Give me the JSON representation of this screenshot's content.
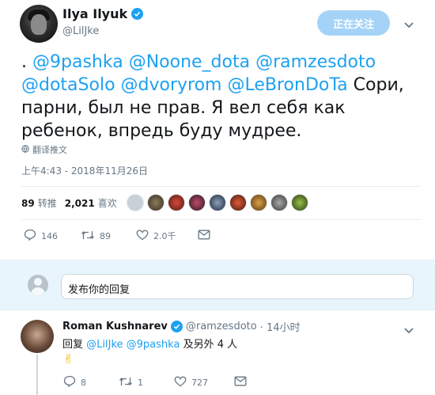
{
  "author": {
    "name": "Ilya Ilyuk",
    "handle": "@LilJke",
    "follow_label": "正在关注"
  },
  "tweet": {
    "prefix": ". ",
    "mentions": [
      "@9pashka",
      "@Noone_dota",
      "@ramzesdoto",
      "@dotaSolo",
      "@dvoryrom",
      "@LeBronDoTa"
    ],
    "body": "Сори, парни, был не прав. Я вел себя как ребенок, впредь буду мудрее.",
    "translate_label": "翻译推文",
    "timestamp": "上午4:43 - 2018年11月26日"
  },
  "stats": {
    "retweets_count": "89",
    "retweets_label": "转推",
    "likes_count": "2,021",
    "likes_label": "喜欢"
  },
  "actions": {
    "replies": "146",
    "retweets": "89",
    "likes": "2.0千"
  },
  "reply_box": {
    "placeholder": "发布你的回复"
  },
  "reply": {
    "name": "Roman Kushnarev",
    "handle": "@ramzesdoto",
    "time": "· 14小时",
    "replying_to_prefix": "回复",
    "replying_to_users": "@LilJke @9pashka",
    "replying_to_suffix": "及另外 4 人",
    "text": "✌",
    "replies": "8",
    "retweets": "1",
    "likes": "727"
  },
  "colors": {
    "accent": "#1da1f2",
    "muted": "#657786",
    "follow_button": "#a4d3f7",
    "reply_area": "#e8f5fd"
  }
}
